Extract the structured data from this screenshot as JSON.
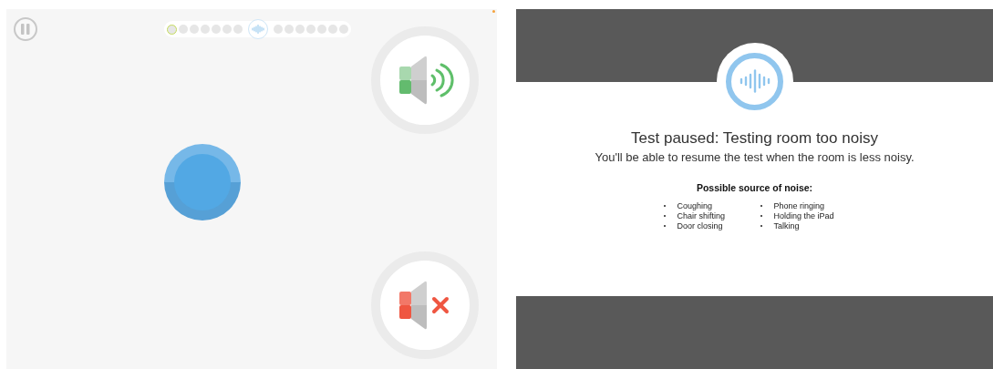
{
  "test_screen": {
    "progress": {
      "steps_before": [
        {
          "current": true
        },
        {
          "current": false
        },
        {
          "current": false
        },
        {
          "current": false
        },
        {
          "current": false
        },
        {
          "current": false
        },
        {
          "current": false
        }
      ],
      "steps_after": [
        {
          "current": false
        },
        {
          "current": false
        },
        {
          "current": false
        },
        {
          "current": false
        },
        {
          "current": false
        },
        {
          "current": false
        },
        {
          "current": false
        }
      ]
    },
    "sound_buttons": [
      {
        "kind": "sound-on"
      },
      {
        "kind": "sound-off"
      }
    ]
  },
  "pause_dialog": {
    "title": "Test paused: Testing room too noisy",
    "message": "You'll be able to resume the test when the room is less noisy.",
    "sources_heading": "Possible source of noise:",
    "source_columns": [
      [
        "Coughing",
        "Chair shifting",
        "Door closing"
      ],
      [
        "Phone ringing",
        "Holding the iPad",
        "Talking"
      ]
    ]
  }
}
